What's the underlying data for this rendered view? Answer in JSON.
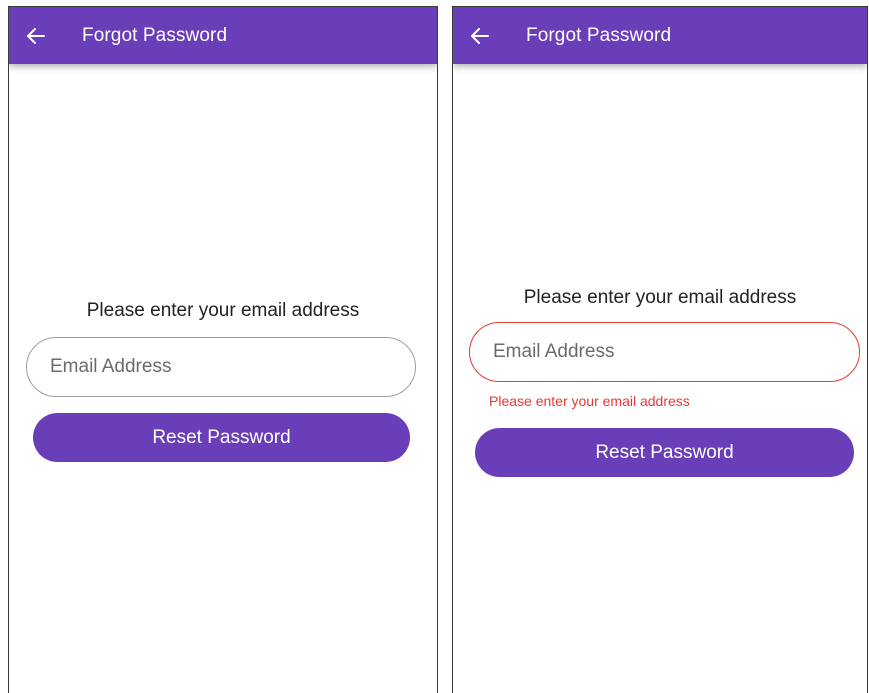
{
  "screens": [
    {
      "appbar": {
        "title": "Forgot Password",
        "back_icon": "arrow-left-icon",
        "color": "#6a3db9"
      },
      "prompt": "Please enter your email address",
      "email": {
        "placeholder": "Email Address",
        "value": "",
        "state": "default"
      },
      "reset_button_label": "Reset Password"
    },
    {
      "appbar": {
        "title": "Forgot Password",
        "back_icon": "arrow-left-icon",
        "color": "#6a3db9"
      },
      "prompt": "Please enter your email address",
      "email": {
        "placeholder": "Email Address",
        "value": "",
        "state": "error",
        "error_message": "Please enter your email address",
        "error_color": "#e53935"
      },
      "reset_button_label": "Reset Password"
    }
  ]
}
